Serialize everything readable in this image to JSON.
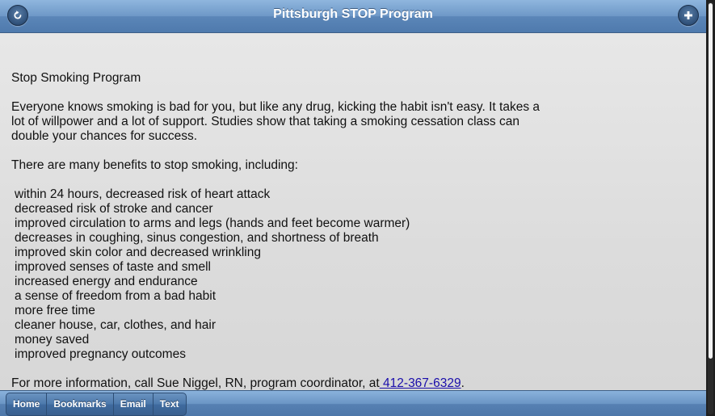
{
  "header": {
    "title": "Pittsburgh STOP Program",
    "back_icon": "back-arrow-icon",
    "add_icon": "plus-icon"
  },
  "content": {
    "heading": "Stop Smoking Program",
    "intro_line1": "Everyone knows smoking is bad for you, but like any drug, kicking the habit isn't easy. It takes a",
    "intro_line2": "lot of willpower and a lot of support. Studies show that taking a smoking cessation class can",
    "intro_line3": "double your chances for success.",
    "benefits_intro": "There are many benefits to stop smoking, including:",
    "benefits": [
      "within 24 hours, decreased risk of heart attack",
      "decreased risk of stroke and cancer",
      "improved circulation to arms and legs (hands and feet become warmer)",
      "decreases in coughing, sinus congestion, and shortness of breath",
      "improved skin color and decreased wrinkling",
      "improved senses of taste and smell",
      "increased energy and endurance",
      "a sense of freedom from a bad habit",
      "more free time",
      "cleaner house, car, clothes, and hair",
      "money saved",
      "improved pregnancy outcomes"
    ],
    "contact_text": "For more information, call Sue Niggel, RN, program coordinator, at",
    "phone": " 412-367-6329",
    "contact_end": "."
  },
  "footer": {
    "nav": [
      {
        "label": "Home"
      },
      {
        "label": "Bookmarks"
      },
      {
        "label": "Email"
      },
      {
        "label": "Text"
      }
    ]
  },
  "colors": {
    "header_blue": "#6e98c7",
    "link": "#1a0dab",
    "background": "#dcdcdc"
  }
}
